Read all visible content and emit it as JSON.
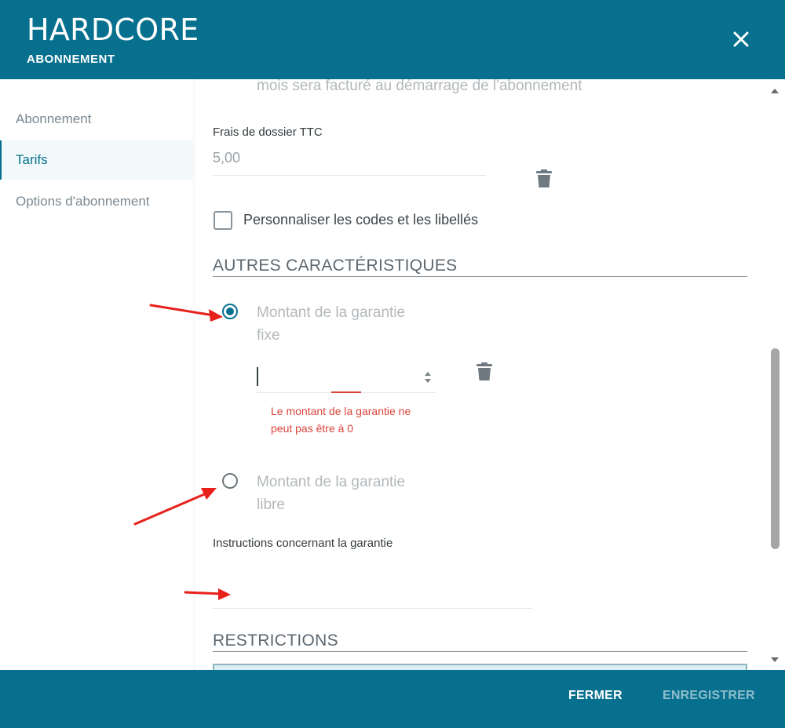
{
  "header": {
    "title": "HARDCORE",
    "subtitle": "ABONNEMENT",
    "close_icon": "close-icon"
  },
  "sidebar": {
    "items": [
      {
        "label": "Abonnement",
        "active": false
      },
      {
        "label": "Tarifs",
        "active": true
      },
      {
        "label": "Options d'abonnement",
        "active": false
      }
    ]
  },
  "content": {
    "top_text": "mois sera facturé au démarrage de l'abonnement",
    "frais": {
      "label": "Frais de dossier TTC",
      "value": "5,00"
    },
    "customize_checkbox": {
      "label": "Personnaliser les codes et les libellés",
      "checked": false
    },
    "autres_section_title": "AUTRES CARACTÉRISTIQUES",
    "garantie_fixe": {
      "label_line1": "Montant de la garantie",
      "label_line2": "fixe",
      "selected": true,
      "input_value": "",
      "error_line1": "Le montant de la garantie ne",
      "error_line2": "peut pas être à 0"
    },
    "garantie_libre": {
      "label_line1": "Montant de la garantie",
      "label_line2": "libre",
      "selected": false
    },
    "instructions": {
      "label": "Instructions concernant la garantie",
      "value": ""
    },
    "restrictions_section_title": "RESTRICTIONS"
  },
  "footer": {
    "close_label": "FERMER",
    "save_label": "ENREGISTRER"
  },
  "colors": {
    "primary": "#07708f",
    "error": "#d9453b",
    "annotation_arrow": "#e8201c"
  }
}
